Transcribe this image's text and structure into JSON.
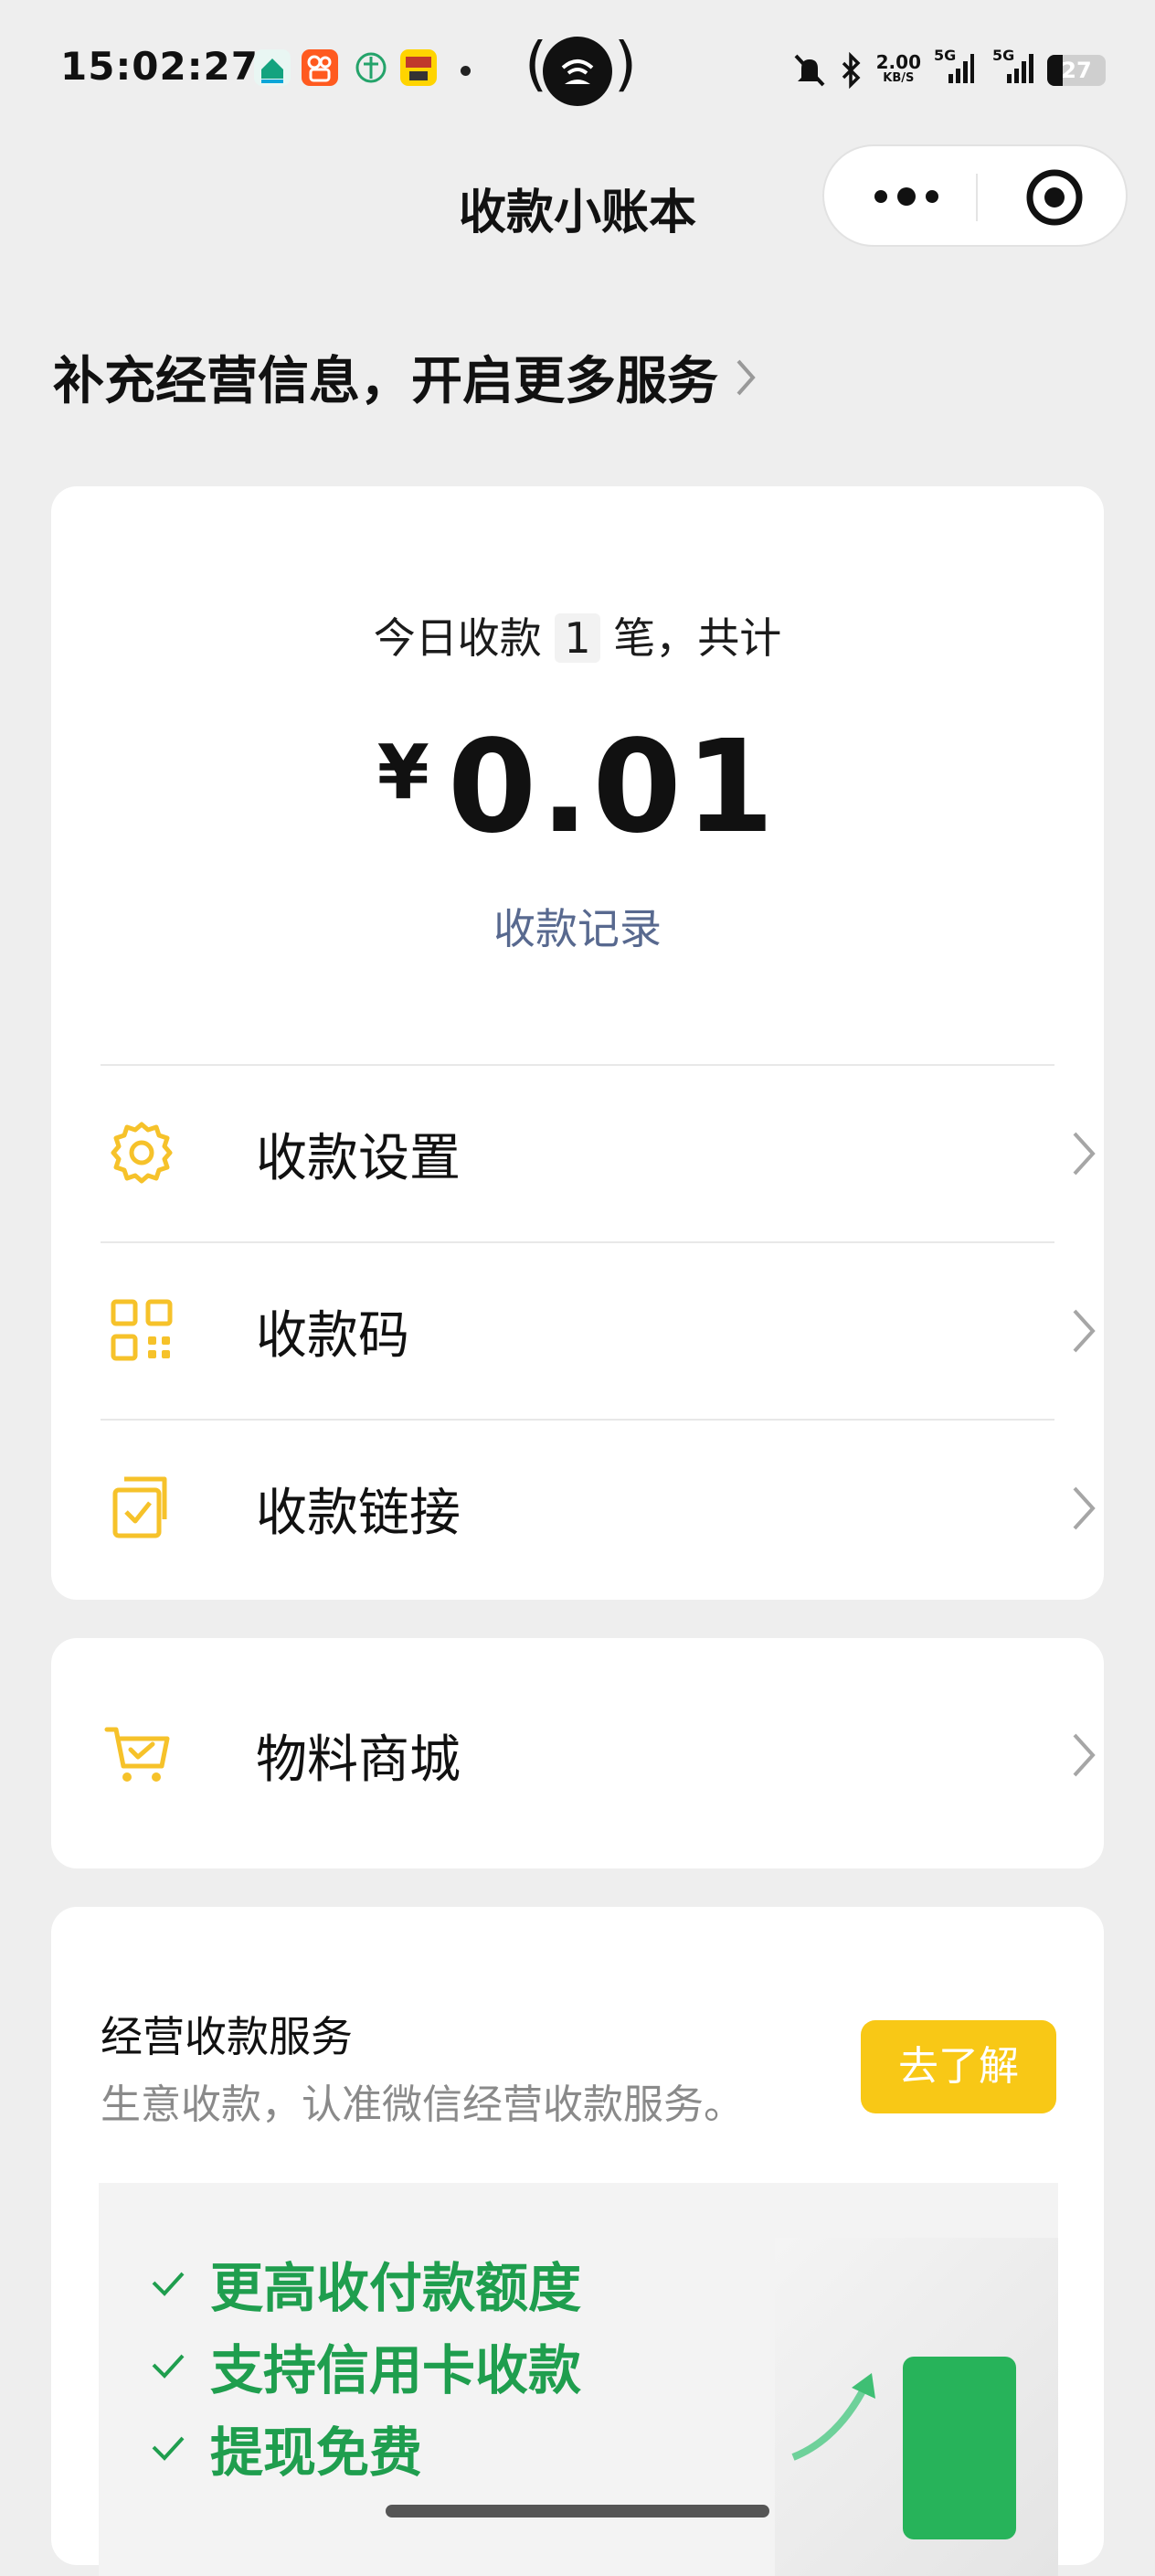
{
  "status_bar": {
    "time": "15:02:27",
    "net_speed_value": "2.00",
    "net_speed_unit": "KB/S",
    "signal1": "5G",
    "signal2": "5G",
    "battery_level": "27",
    "notification_icons": [
      "vivo-home-icon",
      "kuaishou-icon",
      "network-icon",
      "game-icon"
    ],
    "hotspot_icon": "wifi-hotspot-icon"
  },
  "header": {
    "title": "收款小账本",
    "more_icon": "more-dots-icon",
    "close_icon": "target-close-icon"
  },
  "promo": {
    "text": "补充经营信息，开启更多服务"
  },
  "summary": {
    "count_prefix": "今日收款",
    "count_value": "1",
    "count_suffix": "笔，共计",
    "currency": "¥",
    "amount": "0.01",
    "records_link": "收款记录"
  },
  "menu": {
    "items": [
      {
        "label": "收款设置",
        "icon": "gear-icon"
      },
      {
        "label": "收款码",
        "icon": "qr-code-icon"
      },
      {
        "label": "收款链接",
        "icon": "link-check-icon"
      }
    ]
  },
  "shop": {
    "label": "物料商城",
    "icon": "cart-icon"
  },
  "service": {
    "title": "经营收款服务",
    "subtitle": "生意收款，认准微信经营收款服务。",
    "button": "去了解",
    "features": [
      "更高收付款额度",
      "支持信用卡收款",
      "提现免费"
    ]
  },
  "colors": {
    "accent_yellow": "#f8c816",
    "link_blue": "#58698f",
    "feature_green": "#1f9e4e",
    "background": "#eeeeee"
  }
}
